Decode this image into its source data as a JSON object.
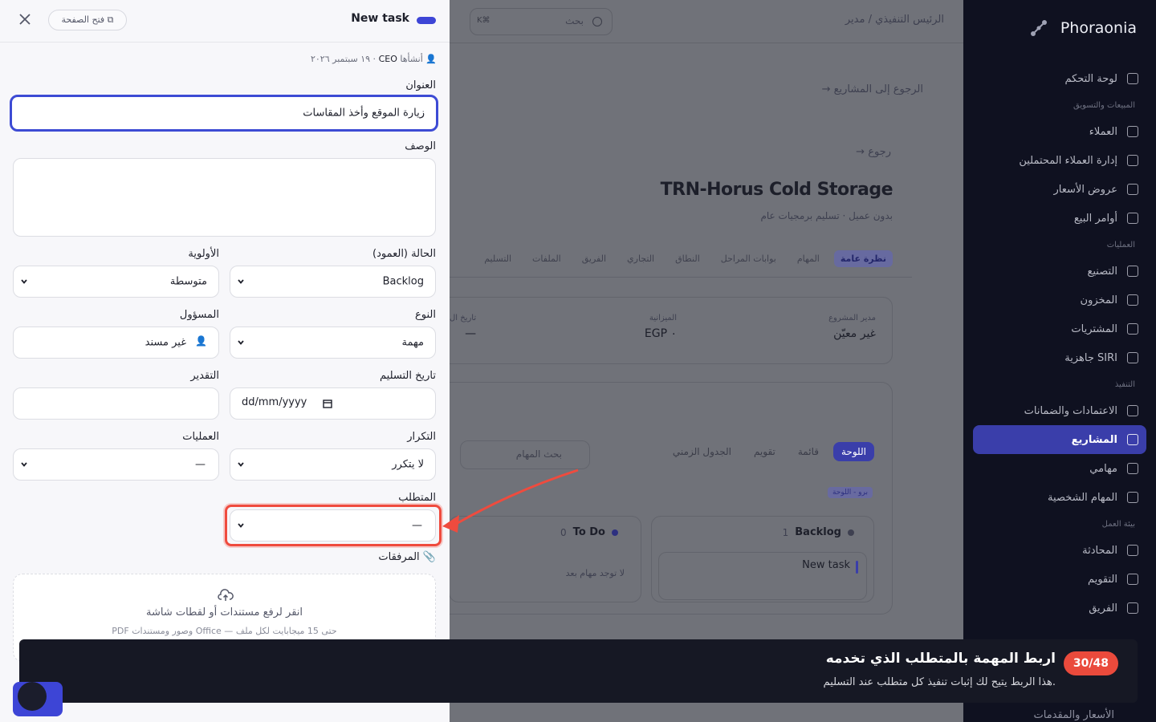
{
  "sidebar": {
    "brand": "Phoraonia",
    "items": [
      {
        "type": "item",
        "label": "لوحة التحكم"
      },
      {
        "type": "section",
        "label": "المبيعات والتسويق"
      },
      {
        "type": "item",
        "label": "العملاء"
      },
      {
        "type": "item",
        "label": "إدارة العملاء المحتملين"
      },
      {
        "type": "item",
        "label": "عروض الأسعار"
      },
      {
        "type": "item",
        "label": "أوامر البيع"
      },
      {
        "type": "section",
        "label": "العمليات"
      },
      {
        "type": "item",
        "label": "التصنيع"
      },
      {
        "type": "item",
        "label": "المخزون"
      },
      {
        "type": "item",
        "label": "المشتريات"
      },
      {
        "type": "item",
        "label": "جاهزية SIRI"
      },
      {
        "type": "section",
        "label": "التنفيذ"
      },
      {
        "type": "item",
        "label": "الاعتمادات والضمانات"
      },
      {
        "type": "item",
        "label": "المشاريع",
        "active": true
      },
      {
        "type": "item",
        "label": "مهامي"
      },
      {
        "type": "item",
        "label": "المهام الشخصية"
      },
      {
        "type": "section",
        "label": "بيئة العمل"
      },
      {
        "type": "item",
        "label": "المحادثة"
      },
      {
        "type": "item",
        "label": "التقويم"
      },
      {
        "type": "item",
        "label": "الفريق"
      }
    ],
    "partial_bottom": "الأسعار والمقدمات"
  },
  "topbar": {
    "breadcrumb": "الرئيس التنفيذي / مدير",
    "search_label": "بحث",
    "search_kbd": "K⌘"
  },
  "project": {
    "back_projects": "الرجوع إلى المشاريع",
    "back": "رجوع",
    "title": "TRN-Horus Cold Storage",
    "subtitle": "بدون عميل · تسليم برمجيات عام",
    "tabs": [
      "نظرة عامة",
      "المهام",
      "بوابات المراحل",
      "النطاق",
      "التجاري",
      "الفريق",
      "الملفات",
      "التسليم"
    ],
    "stats": [
      {
        "label": "مدير المشروع",
        "value": "غير معيّن"
      },
      {
        "label": "الميزانية",
        "value": "EGP ٠"
      },
      {
        "label": "تاريخ ال",
        "value": "—"
      }
    ],
    "views": [
      "اللوحة",
      "قائمة",
      "تقويم",
      "الجدول الزمني"
    ],
    "task_search": "بحث المهام",
    "pro_badge": "برو - اللوحة",
    "columns": [
      {
        "name": "Backlog",
        "count": "1",
        "card": "New task"
      },
      {
        "name": "To Do",
        "count": "0",
        "empty": "لا توجد مهام بعد"
      }
    ]
  },
  "drawer": {
    "title": "New task",
    "open_page": "فتح الصفحة",
    "meta_creator": "CEO",
    "meta_created": "أنشأها",
    "meta_date": "١٩ سبتمبر ٢٠٢٦",
    "labels": {
      "title": "العنوان",
      "description": "الوصف",
      "status": "الحالة (العمود)",
      "priority": "الأولوية",
      "type": "النوع",
      "assignee": "المسؤول",
      "due": "تاريخ التسليم",
      "estimate": "التقدير",
      "repeat": "التكرار",
      "operations": "العمليات",
      "requirement": "المتطلب",
      "attachments": "المرفقات"
    },
    "values": {
      "title": "زيارة الموقع وأخذ المقاسات",
      "status": "Backlog",
      "priority": "متوسطة",
      "type": "مهمة",
      "assignee": "غير مسند",
      "due": "dd/mm/yyyy",
      "repeat": "لا يتكرر",
      "operations": "—",
      "requirement": "—"
    },
    "upload_main": "انقر لرفع مستندات أو لقطات شاشة",
    "upload_sub": "PDF وصور ومستندات Office — حتى 15 ميجابايت لكل ملف"
  },
  "tutorial": {
    "step": "30/48",
    "title": "اربط المهمة بالمتطلب الذي تخدمه",
    "subtitle": "هذا الربط يتيح لك إثبات تنفيذ كل متطلب عند التسليم."
  },
  "colors": {
    "accent": "#3d45d6",
    "highlight": "#ef4b3e",
    "banner": "#161824",
    "sidebar": "#0f1120"
  }
}
